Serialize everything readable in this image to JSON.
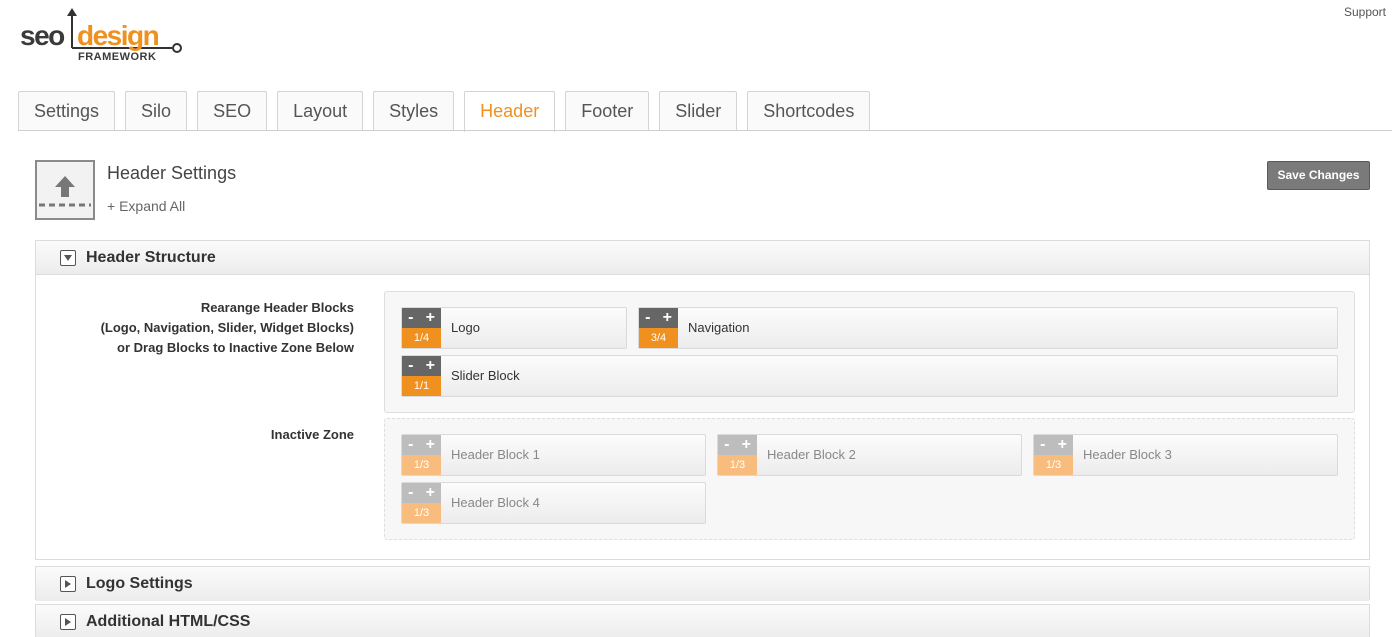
{
  "support": "Support",
  "logo": {
    "seo": "seo",
    "design": "design",
    "framework": "FRAMEWORK"
  },
  "tabs": [
    {
      "label": "Settings",
      "active": false
    },
    {
      "label": "Silo",
      "active": false
    },
    {
      "label": "SEO",
      "active": false
    },
    {
      "label": "Layout",
      "active": false
    },
    {
      "label": "Styles",
      "active": false
    },
    {
      "label": "Header",
      "active": true
    },
    {
      "label": "Footer",
      "active": false
    },
    {
      "label": "Slider",
      "active": false
    },
    {
      "label": "Shortcodes",
      "active": false
    }
  ],
  "page": {
    "title": "Header Settings",
    "expand_all": "+ Expand All",
    "save": "Save Changes"
  },
  "sections": {
    "header_structure": "Header Structure",
    "logo_settings": "Logo Settings",
    "additional": "Additional HTML/CSS"
  },
  "labels": {
    "rearrange_1": "Rearange Header Blocks",
    "rearrange_2": "(Logo, Navigation, Slider, Widget Blocks)",
    "rearrange_3": "or Drag Blocks to Inactive Zone Below",
    "inactive": "Inactive Zone"
  },
  "controls": {
    "minus": "-",
    "plus": "+"
  },
  "active_blocks": [
    {
      "name": "Logo",
      "size": "1/4"
    },
    {
      "name": "Navigation",
      "size": "3/4"
    },
    {
      "name": "Slider Block",
      "size": "1/1"
    }
  ],
  "inactive_blocks": [
    {
      "name": "Header Block 1",
      "size": "1/3"
    },
    {
      "name": "Header Block 2",
      "size": "1/3"
    },
    {
      "name": "Header Block 3",
      "size": "1/3"
    },
    {
      "name": "Header Block 4",
      "size": "1/3"
    }
  ],
  "colors": {
    "accent": "#f0901e",
    "accent_light": "#f8bd7e",
    "control": "#666666",
    "button": "#7a7a7a"
  }
}
